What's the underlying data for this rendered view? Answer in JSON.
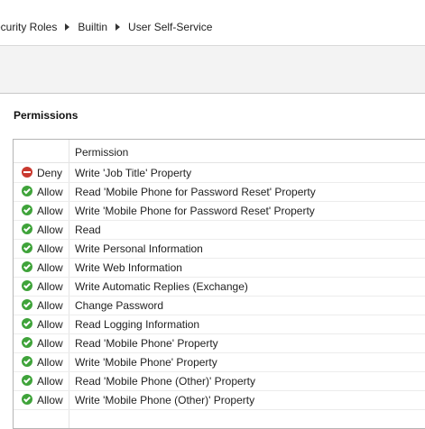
{
  "breadcrumb": [
    "ecurity Roles",
    "Builtin",
    "User Self-Service"
  ],
  "section_title": "Permissions",
  "grid": {
    "header": "Permission",
    "rows": [
      {
        "status": "Deny",
        "permission": "Write 'Job Title' Property"
      },
      {
        "status": "Allow",
        "permission": "Read 'Mobile Phone for Password Reset' Property"
      },
      {
        "status": "Allow",
        "permission": "Write 'Mobile Phone for Password Reset' Property"
      },
      {
        "status": "Allow",
        "permission": "Read"
      },
      {
        "status": "Allow",
        "permission": "Write Personal Information"
      },
      {
        "status": "Allow",
        "permission": "Write Web Information"
      },
      {
        "status": "Allow",
        "permission": "Write Automatic Replies (Exchange)"
      },
      {
        "status": "Allow",
        "permission": "Change Password"
      },
      {
        "status": "Allow",
        "permission": "Read Logging Information"
      },
      {
        "status": "Allow",
        "permission": "Read 'Mobile Phone' Property"
      },
      {
        "status": "Allow",
        "permission": "Write 'Mobile Phone' Property"
      },
      {
        "status": "Allow",
        "permission": "Read 'Mobile Phone (Other)' Property"
      },
      {
        "status": "Allow",
        "permission": "Write 'Mobile Phone (Other)' Property"
      }
    ]
  },
  "colors": {
    "allow": "#3fa33a",
    "deny": "#c9392f"
  }
}
